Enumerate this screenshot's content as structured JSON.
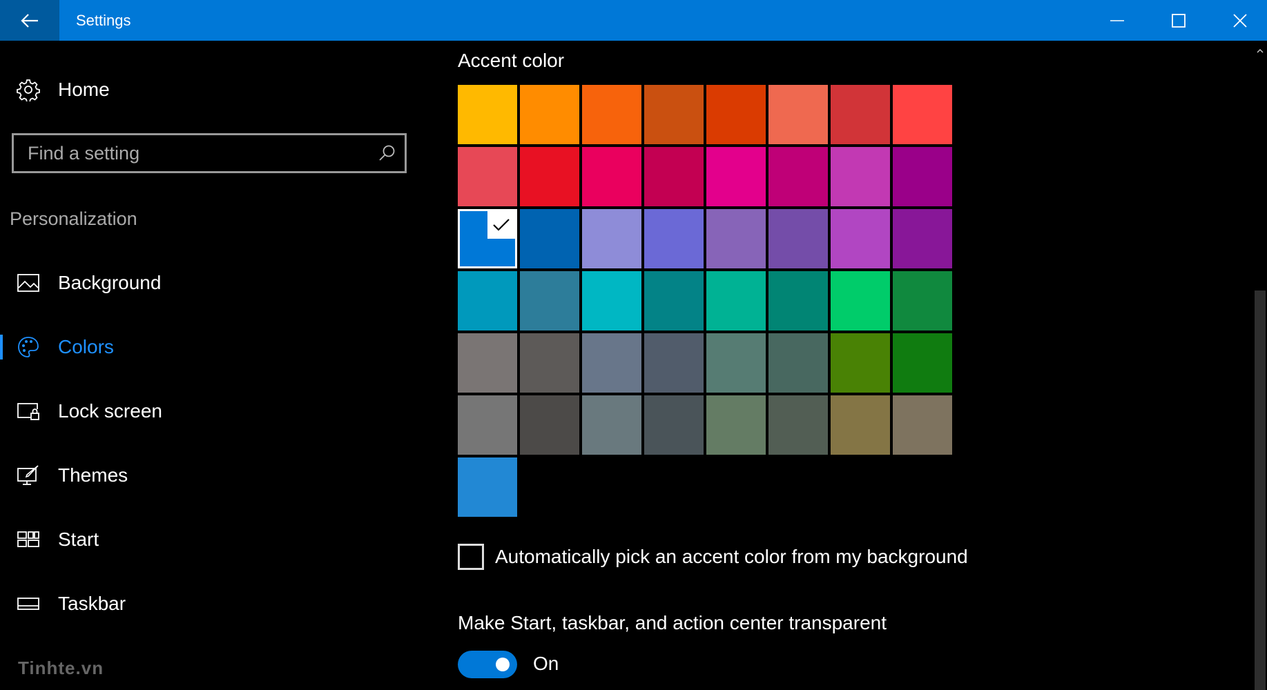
{
  "window": {
    "title": "Settings"
  },
  "sidebar": {
    "home_label": "Home",
    "search": {
      "placeholder": "Find a setting"
    },
    "section_title": "Personalization",
    "items": [
      {
        "label": "Background",
        "icon": "picture-icon",
        "active": false
      },
      {
        "label": "Colors",
        "icon": "palette-icon",
        "active": true
      },
      {
        "label": "Lock screen",
        "icon": "lock-screen-icon",
        "active": false
      },
      {
        "label": "Themes",
        "icon": "themes-icon",
        "active": false
      },
      {
        "label": "Start",
        "icon": "start-icon",
        "active": false
      },
      {
        "label": "Taskbar",
        "icon": "taskbar-icon",
        "active": false
      }
    ],
    "watermark": "Tinhte.vn"
  },
  "main": {
    "accent_title": "Accent color",
    "colors": [
      [
        "#FFB900",
        "#FF8C00",
        "#F7630C",
        "#CA5010",
        "#DA3B01",
        "#EF6950",
        "#D13438",
        "#FF4343"
      ],
      [
        "#E74856",
        "#E81123",
        "#EA005E",
        "#C30052",
        "#E3008C",
        "#BF0077",
        "#C239B3",
        "#9A0089"
      ],
      [
        "#0078D7",
        "#0063B1",
        "#8E8CD8",
        "#6B69D6",
        "#8764B8",
        "#744DA9",
        "#B146C2",
        "#881798"
      ],
      [
        "#0099BC",
        "#2D7D9A",
        "#00B7C3",
        "#038387",
        "#00B294",
        "#018574",
        "#00CC6A",
        "#10893E"
      ],
      [
        "#7A7574",
        "#5D5A58",
        "#68768A",
        "#515C6B",
        "#567C73",
        "#486860",
        "#498205",
        "#107C10"
      ],
      [
        "#767676",
        "#4C4A48",
        "#69797E",
        "#4A5459",
        "#647C64",
        "#525E54",
        "#847545",
        "#7E735F"
      ],
      [
        "#2288D4"
      ]
    ],
    "selected_color": "#0078D7",
    "auto_pick_label": "Automatically pick an accent color from my background",
    "auto_pick_checked": false,
    "transparency_label": "Make Start, taskbar, and action center transparent",
    "transparency_state": "On",
    "transparency_on": true
  }
}
